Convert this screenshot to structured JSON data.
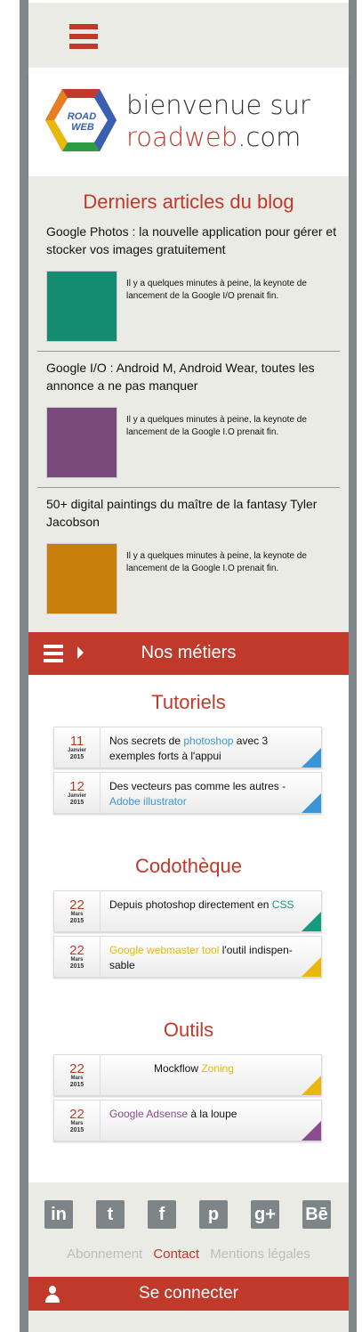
{
  "brand": {
    "logo_text_top": "ROAD",
    "logo_text_bottom": "WEB",
    "line1": "bienvenue sur",
    "domain_red": "roadweb",
    "domain_tld": ".com"
  },
  "blog": {
    "title": "Derniers articles du blog",
    "articles": [
      {
        "title": "Google Photos : la nouvelle application pour gérer et stocker vos images gratuitement",
        "excerpt": "Il y a quelques minutes à peine, la keynote de lancement de la Google I/O prenait fin.",
        "thumb_color": "#148c70"
      },
      {
        "title": "Google I/O : Android M, Android Wear, toutes les annonce a ne pas manquer",
        "excerpt": "Il y a quelques minutes à peine, la keynote de lancement de la Google I.O prenait fin.",
        "thumb_color": "#7b4a7d"
      },
      {
        "title": "50+ digital paintings du maître de la fantasy Tyler Jacobson",
        "excerpt": "Il y a quelques minutes à peine, la keynote de lancement de la Google I.O prenait fin.",
        "thumb_color": "#c87f0c"
      }
    ]
  },
  "metiers": {
    "title": "Nos métiers"
  },
  "tutoriels": {
    "title": "Tutoriels",
    "cards": [
      {
        "day": "11",
        "month": "Janvier",
        "year": "2015",
        "text_before": "Nos secrets de ",
        "highlight": "photoshop",
        "text_after": " avec 3 exemples forts à l'appui",
        "corner": "#3a95d6"
      },
      {
        "day": "12",
        "month": "Janvier",
        "year": "2015",
        "text_before": "Des vecteurs pas comme les autres - ",
        "highlight": "Adobe illustrator",
        "text_after": "",
        "corner": "#3a95d6"
      }
    ]
  },
  "codotheque": {
    "title": "Codothèque",
    "cards": [
      {
        "day": "22",
        "month": "Mars",
        "year": "2015",
        "text_before": "Depuis photoshop directement en ",
        "highlight": "CSS",
        "text_after": "",
        "corner": "#159c7e"
      },
      {
        "day": "22",
        "month": "Mars",
        "year": "2015",
        "text_before": "",
        "highlight": "Google webmaster tool",
        "text_after": " l'outil indispen- sable",
        "corner": "#e8b80c"
      }
    ]
  },
  "outils": {
    "title": "Outils",
    "cards": [
      {
        "day": "22",
        "month": "Mars",
        "year": "2015",
        "text_before": "Mockflow ",
        "highlight": "Zoning",
        "text_after": "",
        "corner": "#e8b80c"
      },
      {
        "day": "22",
        "month": "Mars",
        "year": "2015",
        "text_before": "",
        "highlight": "Google Adsense",
        "text_after": " à la loupe",
        "corner": "#8a4b8f"
      }
    ]
  },
  "social": [
    "in",
    "t",
    "f",
    "p",
    "g+",
    "Bē"
  ],
  "footer_links": {
    "abonnement": "Abonnement",
    "contact": "Contact",
    "mentions": "Mentions légales"
  },
  "login": {
    "label": "Se connecter"
  },
  "colors": {
    "accent": "#c0392b",
    "panel": "#ebebe6",
    "social": "#7e8587"
  }
}
